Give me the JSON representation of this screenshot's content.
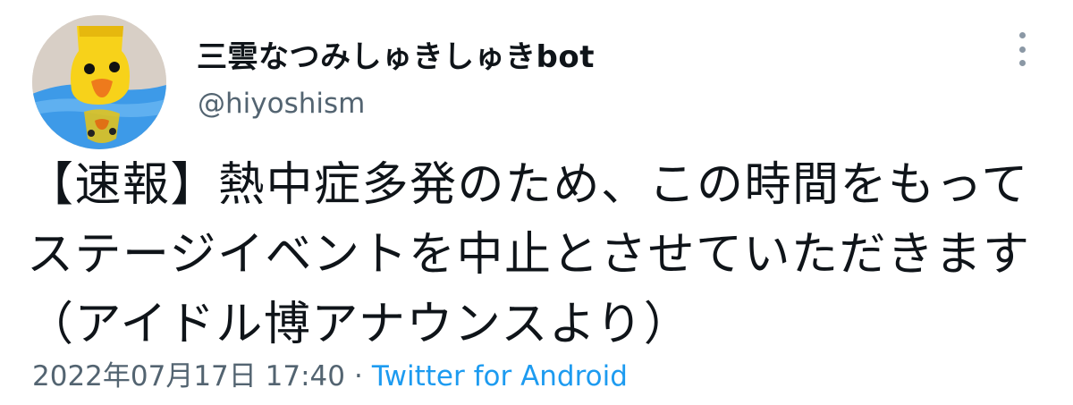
{
  "tweet": {
    "display_name": "三雲なつみしゅきしゅきbot",
    "handle": "@hiyoshism",
    "more_icon": "more-vertical-icon",
    "text": "【速報】熱中症多発のため、この時間をもってステージイベントを中止とさせていただきます（アイドル博アナウンスより）",
    "timestamp": "2022年07月17日 17:40",
    "separator": "·",
    "source": "Twitter for Android"
  },
  "colors": {
    "text": "#0f1419",
    "secondary": "#536471",
    "link": "#1d9bf0"
  }
}
